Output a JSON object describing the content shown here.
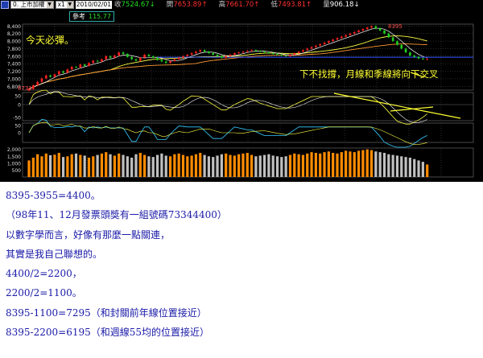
{
  "toolbar": {
    "market_select": "0. 上市加權",
    "period_select": "x1",
    "date": "2010/02/01",
    "close_label": "收",
    "close_value": "7524.67↓",
    "open_label": "開",
    "open_value": "7653.89↑",
    "high_label": "高",
    "high_value": "7661.70↑",
    "low_label": "低",
    "low_value": "7493.81↑",
    "volume_label": "量",
    "volume_value": "906.18↓"
  },
  "reference_box": {
    "label": "參考",
    "value": "115.77"
  },
  "annotations": {
    "today_note": "今天必彈。",
    "peak_label": "8395",
    "bottom_label": "6731",
    "trend_note": "下不找撐，月線和季線將向下交叉"
  },
  "price_axis_ticks": [
    "8,400",
    "8,200",
    "8,000",
    "7,800",
    "7,600",
    "7,400",
    "7,200",
    "7,000",
    "6,800"
  ],
  "macd_ticks": [
    "50",
    "0",
    "-50"
  ],
  "osc_ticks": [
    "50",
    "0"
  ],
  "volume_ticks": [
    "2,000",
    "1,500",
    "1,000",
    "500"
  ],
  "colors": {
    "up_candle": "#ff2020",
    "down_candle": "#20d020",
    "ma_yellow": "#ffff44",
    "ma_orange": "#ff9933",
    "ma_white": "#ffffff",
    "macd_cyan": "#33ccff",
    "volume_orange": "#ff8c00",
    "volume_gray": "#c0c0c0",
    "post_text": "#1a1aa8"
  },
  "post": {
    "lines": [
      "8395-3955=4400。",
      "（98年11、12月發票頭獎有一組號碼73344400）",
      "以數字學而言，好像有那麼一點關連，",
      "其實是我自己聯想的。",
      "4400/2=2200，",
      "2200/2=1100。",
      "8395-1100=7295（和封關前年線位置接近）",
      "8395-2200=6195（和週線55均的位置接近）"
    ]
  },
  "chart_data": {
    "type": "candlestick",
    "instrument": "上市加權",
    "date": "2010/02/01",
    "ohlc_latest": {
      "open": 7653.89,
      "high": 7661.7,
      "low": 7493.81,
      "close": 7524.67
    },
    "volume_latest": 906.18,
    "price_range": [
      6700,
      8450
    ],
    "marked_high": 8395,
    "marked_low": 6731,
    "closes": [
      6731,
      6830,
      6920,
      7010,
      7090,
      7050,
      7120,
      7200,
      7160,
      7250,
      7320,
      7300,
      7380,
      7340,
      7420,
      7480,
      7460,
      7520,
      7600,
      7560,
      7620,
      7700,
      7660,
      7580,
      7520,
      7480,
      7560,
      7640,
      7600,
      7560,
      7500,
      7460,
      7420,
      7470,
      7520,
      7560,
      7600,
      7640,
      7680,
      7720,
      7760,
      7720,
      7680,
      7640,
      7600,
      7560,
      7600,
      7640,
      7680,
      7700,
      7720,
      7740,
      7760,
      7740,
      7720,
      7700,
      7680,
      7660,
      7640,
      7620,
      7600,
      7640,
      7680,
      7720,
      7760,
      7800,
      7840,
      7880,
      7920,
      7960,
      8000,
      8040,
      8080,
      8120,
      8160,
      8200,
      8240,
      8280,
      8320,
      8360,
      8395,
      8340,
      8280,
      8200,
      8100,
      8000,
      7900,
      7800,
      7700,
      7620,
      7580,
      7540,
      7520,
      7524
    ],
    "volumes": [
      1200,
      1400,
      1650,
      1500,
      1700,
      1580,
      1620,
      1750,
      1450,
      1500,
      1650,
      1700,
      1600,
      1550,
      1400,
      1500,
      1600,
      1700,
      1800,
      1650,
      1550,
      1700,
      1600,
      1500,
      1400,
      1650,
      1750,
      1600,
      1500,
      1450,
      1600,
      1700,
      1550,
      1500,
      1650,
      1700,
      1600,
      1500,
      1550,
      1650,
      1750,
      1600,
      1500,
      1450,
      1550,
      1650,
      1700,
      1600,
      1550,
      1650,
      1700,
      1750,
      1600,
      1500,
      1550,
      1600,
      1650,
      1550,
      1500,
      1450,
      1500,
      1600,
      1700,
      1650,
      1600,
      1700,
      1800,
      1750,
      1700,
      1800,
      1850,
      1750,
      1700,
      1800,
      1900,
      1850,
      1800,
      1900,
      1950,
      2000,
      1950,
      1850,
      1800,
      1750,
      1650,
      1600,
      1550,
      1500,
      1450,
      1400,
      1300,
      1200,
      1100,
      906
    ]
  }
}
